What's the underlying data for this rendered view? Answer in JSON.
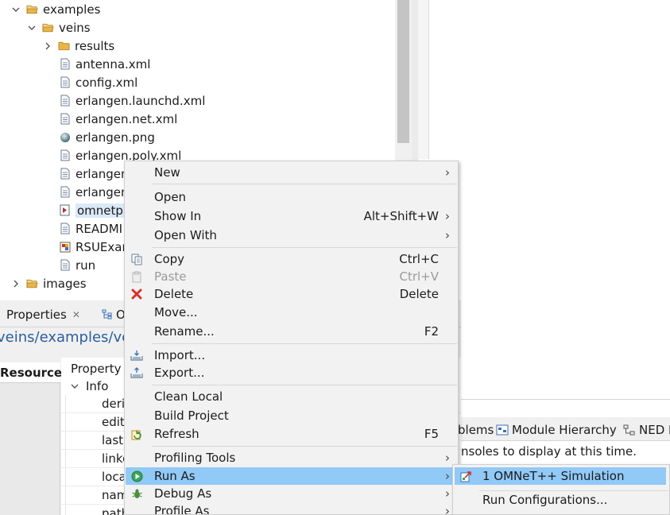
{
  "tree": {
    "items": [
      {
        "label": "examples",
        "type": "folder",
        "expanded": true
      },
      {
        "label": "veins",
        "type": "folder",
        "expanded": true
      },
      {
        "label": "results",
        "type": "folder",
        "expanded": false
      },
      {
        "label": "antenna.xml",
        "type": "xml-file"
      },
      {
        "label": "config.xml",
        "type": "xml-file"
      },
      {
        "label": "erlangen.launchd.xml",
        "type": "xml-file"
      },
      {
        "label": "erlangen.net.xml",
        "type": "xml-file"
      },
      {
        "label": "erlangen.png",
        "type": "image-file"
      },
      {
        "label": "erlangen.poly.xml",
        "type": "xml-file"
      },
      {
        "label": "erlangen",
        "type": "xml-file"
      },
      {
        "label": "erlangen",
        "type": "xml-file"
      },
      {
        "label": "omnetpp",
        "type": "ini-file",
        "selected": true
      },
      {
        "label": "READMI",
        "type": "text-file"
      },
      {
        "label": "RSUExam",
        "type": "ned-file"
      },
      {
        "label": "run",
        "type": "text-file"
      },
      {
        "label": "images",
        "type": "folder",
        "expanded": false
      }
    ]
  },
  "properties": {
    "tab_label": "Properties",
    "tab_close": "✕",
    "other_tab_label": "O",
    "title": "veins/examples/ve",
    "side_tab": "Resource",
    "column_header": "Property",
    "group_label": "Info",
    "rows": [
      "deri",
      "edit",
      "last",
      "linke",
      "loca",
      "nam",
      "path"
    ]
  },
  "right_view": {
    "tabs": [
      {
        "label": "blems"
      },
      {
        "label": "Module Hierarchy"
      },
      {
        "label": "NED I"
      }
    ],
    "message": "nsoles to display at this time."
  },
  "context_menu": {
    "items": [
      {
        "label": "New",
        "accel": "",
        "submenu": true,
        "icon": ""
      },
      {
        "label": "Open",
        "accel": "",
        "submenu": false,
        "icon": ""
      },
      {
        "label": "Show In",
        "accel": "Alt+Shift+W",
        "submenu": true,
        "icon": ""
      },
      {
        "label": "Open With",
        "accel": "",
        "submenu": true,
        "icon": ""
      },
      {
        "label": "Copy",
        "accel": "Ctrl+C",
        "submenu": false,
        "icon": "copy-icon"
      },
      {
        "label": "Paste",
        "accel": "Ctrl+V",
        "submenu": false,
        "icon": "paste-icon",
        "disabled": true
      },
      {
        "label": "Delete",
        "accel": "Delete",
        "submenu": false,
        "icon": "delete-icon"
      },
      {
        "label": "Move...",
        "accel": "",
        "submenu": false,
        "icon": ""
      },
      {
        "label": "Rename...",
        "accel": "F2",
        "submenu": false,
        "icon": ""
      },
      {
        "label": "Import...",
        "accel": "",
        "submenu": false,
        "icon": "import-icon"
      },
      {
        "label": "Export...",
        "accel": "",
        "submenu": false,
        "icon": "export-icon"
      },
      {
        "label": "Clean Local",
        "accel": "",
        "submenu": false,
        "icon": ""
      },
      {
        "label": "Build Project",
        "accel": "",
        "submenu": false,
        "icon": ""
      },
      {
        "label": "Refresh",
        "accel": "F5",
        "submenu": false,
        "icon": "refresh-icon"
      },
      {
        "label": "Profiling Tools",
        "accel": "",
        "submenu": true,
        "icon": ""
      },
      {
        "label": "Run As",
        "accel": "",
        "submenu": true,
        "icon": "run-icon",
        "highlighted": true
      },
      {
        "label": "Debug As",
        "accel": "",
        "submenu": true,
        "icon": "debug-icon"
      },
      {
        "label": "Profile As",
        "accel": "",
        "submenu": true,
        "icon": ""
      }
    ],
    "arrow_glyph": "›"
  },
  "submenu": {
    "items": [
      {
        "label": "1 OMNeT++ Simulation",
        "icon": "omnet-run-icon",
        "highlighted": true
      },
      {
        "label": "Run Configurations...",
        "icon": ""
      }
    ]
  },
  "colors": {
    "highlight": "#91c9f7",
    "title_link": "#2a5f9e",
    "folder": "#e8b54a",
    "run_green": "#3aa55a",
    "delete_red": "#d9302c"
  }
}
